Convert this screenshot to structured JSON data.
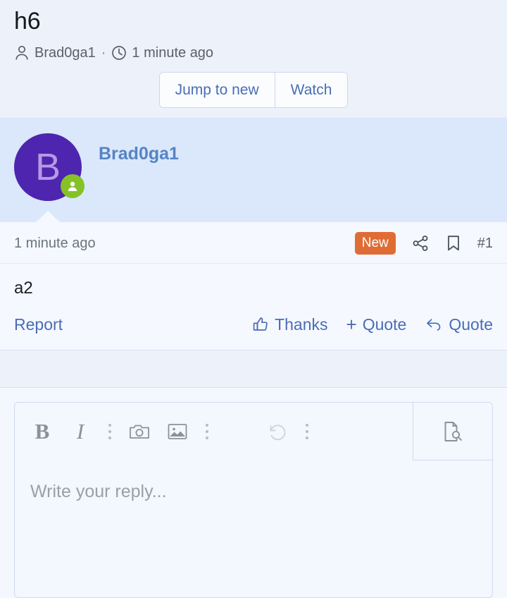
{
  "thread": {
    "title": "h6",
    "author": "Brad0ga1",
    "separator": "·",
    "posted_time": "1 minute ago",
    "author_icon": "user-icon",
    "time_icon": "clock-icon",
    "actions": {
      "jump_to_new": "Jump to new",
      "watch": "Watch"
    }
  },
  "post": {
    "avatar_letter": "B",
    "avatar_color": "#4e25ae",
    "avatar_letter_color": "#b49ae4",
    "online_badge_color": "#85c226",
    "username": "Brad0ga1",
    "date": "1 minute ago",
    "new_badge": "New",
    "new_badge_color": "#e06c35",
    "share_icon": "share-icon",
    "bookmark_icon": "bookmark-icon",
    "post_number": "#1",
    "body": "a2",
    "footer": {
      "report": "Report",
      "thanks": "Thanks",
      "thanks_icon": "thumbs-up-icon",
      "add_quote": "Quote",
      "add_quote_prefix": "+",
      "reply_quote": "Quote",
      "reply_quote_icon": "reply-arrow-icon"
    }
  },
  "editor": {
    "placeholder": "Write your reply...",
    "toolbar": {
      "bold": "B",
      "italic": "I",
      "camera": "camera-icon",
      "image": "image-icon",
      "undo": "undo-icon",
      "more": "more-vertical-icon",
      "preview": "preview-document-icon"
    }
  }
}
